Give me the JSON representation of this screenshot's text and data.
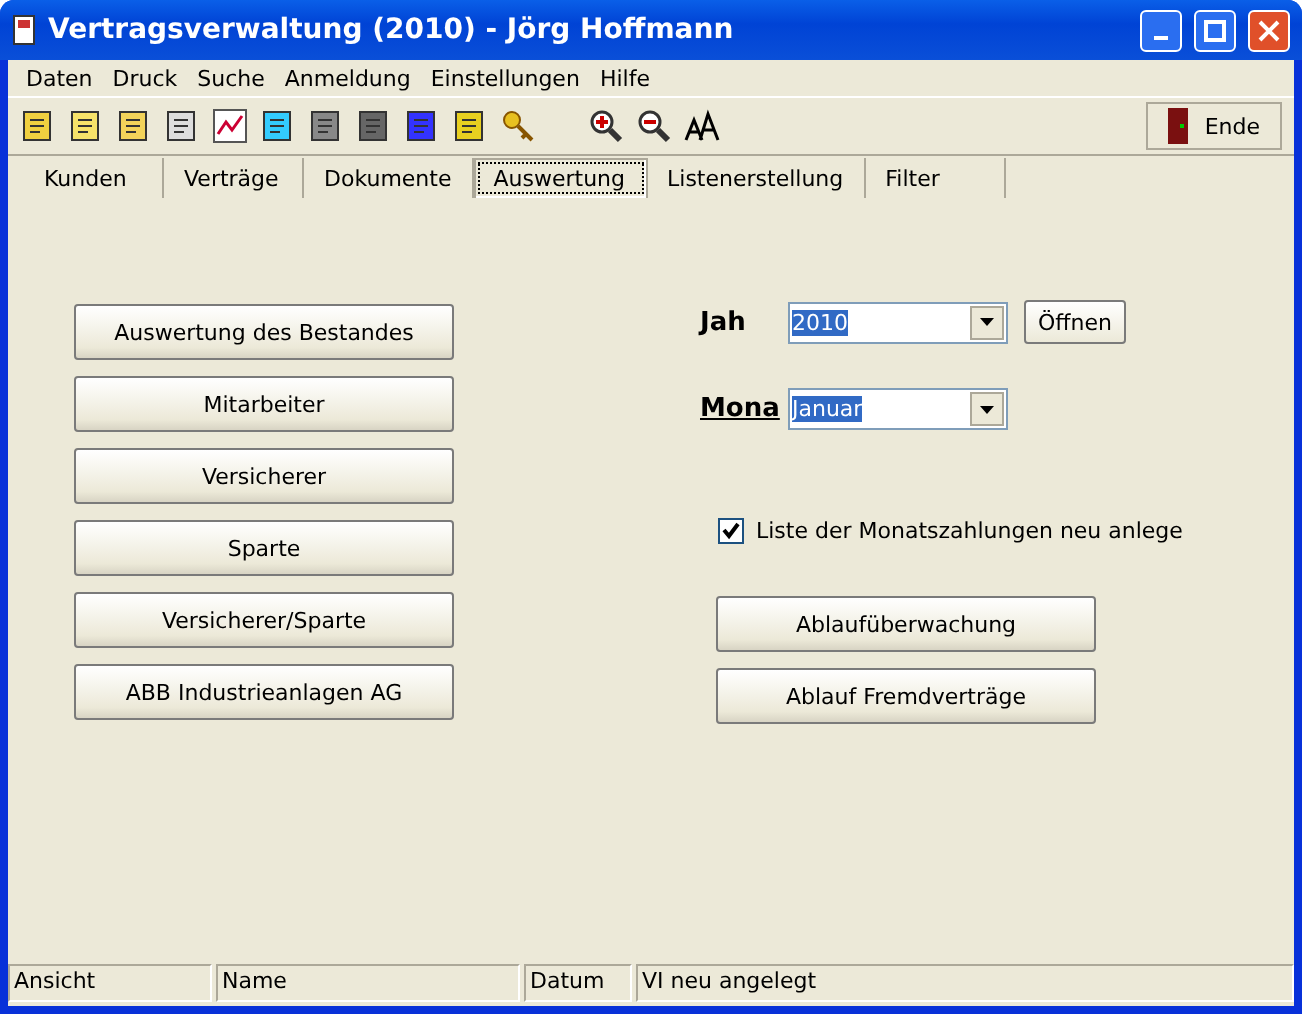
{
  "window": {
    "title": "Vertragsverwaltung (2010) - Jörg Hoffmann"
  },
  "menu": [
    "Daten",
    "Druck",
    "Suche",
    "Anmeldung",
    "Einstellungen",
    "Hilfe"
  ],
  "toolbar": {
    "end_button": "Ende"
  },
  "tabs": [
    {
      "label": "Kunden",
      "selected": false
    },
    {
      "label": "Verträge",
      "selected": false
    },
    {
      "label": "Dokumente",
      "selected": false
    },
    {
      "label": "Auswertung",
      "selected": true
    },
    {
      "label": "Listenerstellung",
      "selected": false
    },
    {
      "label": "Filter",
      "selected": false
    }
  ],
  "left_buttons": [
    "Auswertung des Bestandes",
    "Mitarbeiter",
    "Versicherer",
    "Sparte",
    "Versicherer/Sparte",
    "ABB Industrieanlagen AG"
  ],
  "year": {
    "label": "Jah",
    "value": "2010",
    "open_button": "Öffnen"
  },
  "month": {
    "label": "Mona",
    "value": "Januar"
  },
  "checkbox": {
    "label": "Liste der Monatszahlungen neu anlege",
    "checked": true
  },
  "right_buttons": [
    "Ablaufüberwachung",
    "Ablauf Fremdverträge"
  ],
  "status_bar": [
    "Ansicht",
    "Name",
    "Datum",
    "VI neu angelegt"
  ]
}
